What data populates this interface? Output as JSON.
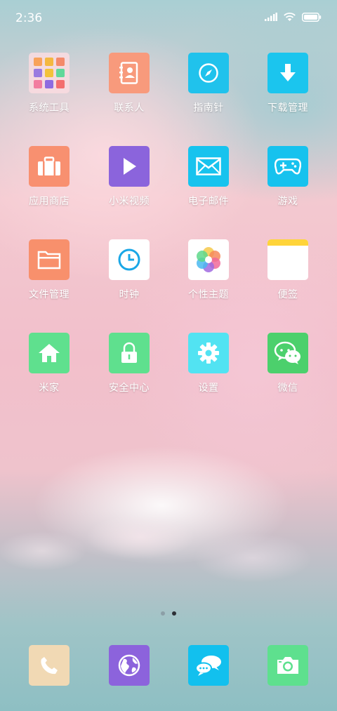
{
  "status_bar": {
    "time": "2:36"
  },
  "apps": [
    {
      "label": "系统工具",
      "icon": "folder-icon",
      "color": "#f6d5d8"
    },
    {
      "label": "联系人",
      "icon": "contacts-icon",
      "color": "#f89a7c"
    },
    {
      "label": "指南针",
      "icon": "compass-icon",
      "color": "#20c2ec"
    },
    {
      "label": "下载管理",
      "icon": "download-icon",
      "color": "#1bc5ee"
    },
    {
      "label": "应用商店",
      "icon": "briefcase-icon",
      "color": "#f89070"
    },
    {
      "label": "小米视频",
      "icon": "play-icon",
      "color": "#8b64dc"
    },
    {
      "label": "电子邮件",
      "icon": "mail-icon",
      "color": "#17c3ee"
    },
    {
      "label": "游戏",
      "icon": "gamepad-icon",
      "color": "#16c2ee"
    },
    {
      "label": "文件管理",
      "icon": "files-icon",
      "color": "#f8906c"
    },
    {
      "label": "时钟",
      "icon": "clock-icon",
      "color": "#ffffff"
    },
    {
      "label": "个性主题",
      "icon": "theme-flower-icon",
      "color": "#ffffff"
    },
    {
      "label": "便签",
      "icon": "notes-icon",
      "color": "#ffffff"
    },
    {
      "label": "米家",
      "icon": "home-icon",
      "color": "#5fe08e"
    },
    {
      "label": "安全中心",
      "icon": "lock-icon",
      "color": "#5fe08e"
    },
    {
      "label": "设置",
      "icon": "gear-icon",
      "color": "#52e3f2"
    },
    {
      "label": "微信",
      "icon": "wechat-icon",
      "color": "#4cd06c"
    }
  ],
  "page_indicator": {
    "count": 2,
    "active_index": 1
  },
  "dock": [
    {
      "name": "phone",
      "icon": "phone-icon",
      "color": "#f1d9b4"
    },
    {
      "name": "browser",
      "icon": "globe-icon",
      "color": "#8c63dc"
    },
    {
      "name": "messages",
      "icon": "messages-icon",
      "color": "#12c0ee"
    },
    {
      "name": "camera",
      "icon": "camera-icon",
      "color": "#5ee08e"
    }
  ]
}
